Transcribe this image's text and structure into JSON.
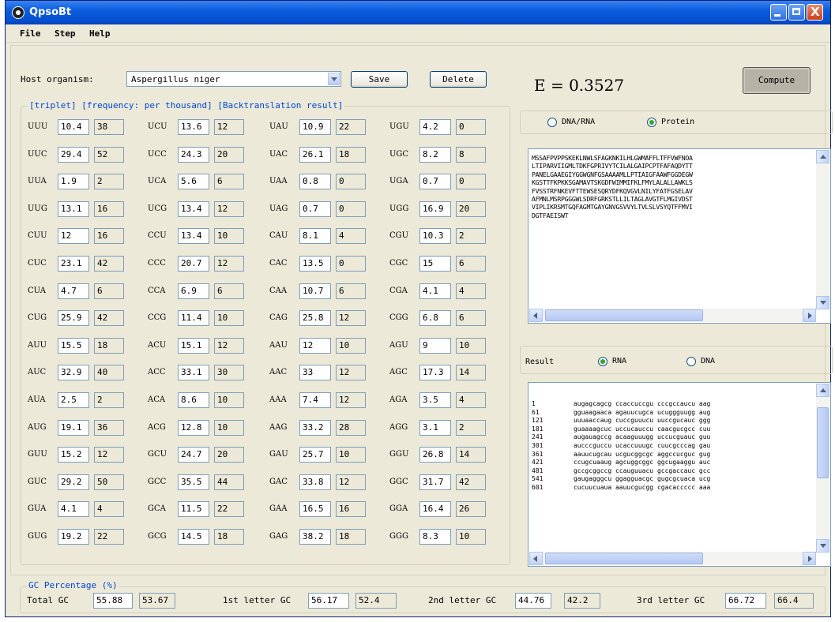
{
  "window": {
    "title": "QpsoBt",
    "close_glyph": "X"
  },
  "menu": [
    "File",
    "Step",
    "Help"
  ],
  "host": {
    "label": "Host organism:",
    "value": "Aspergillus niger",
    "save": "Save",
    "delete": "Delete"
  },
  "energy": "E = 0.3527",
  "compute": "Compute",
  "triplet_group": "[triplet] [frequency: per thousand] [Backtranslation result]",
  "codons": [
    [
      [
        "UUU",
        "10.4",
        "38"
      ],
      [
        "UCU",
        "13.6",
        "12"
      ],
      [
        "UAU",
        "10.9",
        "22"
      ],
      [
        "UGU",
        "4.2",
        "0"
      ]
    ],
    [
      [
        "UUC",
        "29.4",
        "52"
      ],
      [
        "UCC",
        "24.3",
        "20"
      ],
      [
        "UAC",
        "26.1",
        "18"
      ],
      [
        "UGC",
        "8.2",
        "8"
      ]
    ],
    [
      [
        "UUA",
        "1.9",
        "2"
      ],
      [
        "UCA",
        "5.6",
        "6"
      ],
      [
        "UAA",
        "0.8",
        "0"
      ],
      [
        "UGA",
        "0.7",
        "0"
      ]
    ],
    [
      [
        "UUG",
        "13.1",
        "16"
      ],
      [
        "UCG",
        "13.4",
        "12"
      ],
      [
        "UAG",
        "0.7",
        "0"
      ],
      [
        "UGG",
        "16.9",
        "20"
      ]
    ],
    [
      [
        "CUU",
        "12",
        "16"
      ],
      [
        "CCU",
        "13.4",
        "10"
      ],
      [
        "CAU",
        "8.1",
        "4"
      ],
      [
        "CGU",
        "10.3",
        "2"
      ]
    ],
    [
      [
        "CUC",
        "23.1",
        "42"
      ],
      [
        "CCC",
        "20.7",
        "12"
      ],
      [
        "CAC",
        "13.5",
        "0"
      ],
      [
        "CGC",
        "15",
        "6"
      ]
    ],
    [
      [
        "CUA",
        "4.7",
        "6"
      ],
      [
        "CCA",
        "6.9",
        "6"
      ],
      [
        "CAA",
        "10.7",
        "6"
      ],
      [
        "CGA",
        "4.1",
        "4"
      ]
    ],
    [
      [
        "CUG",
        "25.9",
        "42"
      ],
      [
        "CCG",
        "11.4",
        "10"
      ],
      [
        "CAG",
        "25.8",
        "12"
      ],
      [
        "CGG",
        "6.8",
        "6"
      ]
    ],
    [
      [
        "AUU",
        "15.5",
        "18"
      ],
      [
        "ACU",
        "15.1",
        "12"
      ],
      [
        "AAU",
        "12",
        "10"
      ],
      [
        "AGU",
        "9",
        "10"
      ]
    ],
    [
      [
        "AUC",
        "32.9",
        "40"
      ],
      [
        "ACC",
        "33.1",
        "30"
      ],
      [
        "AAC",
        "33",
        "12"
      ],
      [
        "AGC",
        "17.3",
        "14"
      ]
    ],
    [
      [
        "AUA",
        "2.5",
        "2"
      ],
      [
        "ACA",
        "8.6",
        "10"
      ],
      [
        "AAA",
        "7.4",
        "12"
      ],
      [
        "AGA",
        "3.5",
        "4"
      ]
    ],
    [
      [
        "AUG",
        "19.1",
        "36"
      ],
      [
        "ACG",
        "12.8",
        "10"
      ],
      [
        "AAG",
        "33.2",
        "28"
      ],
      [
        "AGG",
        "3.1",
        "2"
      ]
    ],
    [
      [
        "GUU",
        "15.2",
        "12"
      ],
      [
        "GCU",
        "24.7",
        "20"
      ],
      [
        "GAU",
        "25.7",
        "10"
      ],
      [
        "GGU",
        "26.8",
        "14"
      ]
    ],
    [
      [
        "GUC",
        "29.2",
        "50"
      ],
      [
        "GCC",
        "35.5",
        "44"
      ],
      [
        "GAC",
        "33.8",
        "12"
      ],
      [
        "GGC",
        "31.7",
        "42"
      ]
    ],
    [
      [
        "GUA",
        "4.1",
        "4"
      ],
      [
        "GCA",
        "11.5",
        "22"
      ],
      [
        "GAA",
        "16.5",
        "16"
      ],
      [
        "GGA",
        "16.4",
        "26"
      ]
    ],
    [
      [
        "GUG",
        "19.2",
        "22"
      ],
      [
        "GCG",
        "14.5",
        "18"
      ],
      [
        "GAG",
        "38.2",
        "18"
      ],
      [
        "GGG",
        "8.3",
        "10"
      ]
    ]
  ],
  "seq_type": {
    "dna_rna": "DNA/RNA",
    "protein": "Protein",
    "selected": "Protein"
  },
  "protein_seq": [
    "MSSAFPVPPSKEKLNWLSFAGKNKILHLGWMAFFLTFFVWFNOA",
    "LTIPARVIIGMLTDKFGPRIVYTCILALGAIPCPTFAFAQDYTT",
    "PANELGAAEGIYGGWGNFGSAAAAMLLPTIAIGFAAWFGGDEGW",
    "KGSTTFKPKKSGAMAVTSKGDFWIMMIFKLFMYLALALLAWKLS",
    "FVSSTRFNKEVFTTEWSESQRYDFKQVGVLNILYFATFGSELAV",
    "AFMNLMSRPGGGWLSDRFGRKSTLLILTAGLAVGTFLMGIVDST",
    "VIPLIKRSMTGQFAGMTGAYGNVGSVVYLTVLSLVSYQTFFMVI",
    "DGTFAEISWT"
  ],
  "result": {
    "label": "Result",
    "rna": "RNA",
    "dna": "DNA",
    "selected": "RNA"
  },
  "result_lines": [
    "1          augagcagcg ccaccuccgu cccgccaucu aag",
    "61         gguaagaaca agauucugca ucuggguugg aug",
    "121        uuuaaccaug cuccguuucu uuccgucauc ggg",
    "181        guaaaagcuc uccucauccu caacgucgcc cuu",
    "241        augauagccg acaaguuugg uccucguauc guu",
    "301        aucccguccu ucaccuuugc cuucgcccag gau",
    "361        aauucugcau ucgucggcgc aggccucguc gug",
    "421        ccugcuaaug agcuggcggc ggcugaaggu auc",
    "481        gccgcggccg ccauguuacu gccgaccauc gcc",
    "541        gaugagggcu ggagguacgc gugcgcuaca ucg",
    "601        cucuucuaua aauucgucgg cgacaccccc aaa"
  ],
  "gc": {
    "title": "GC Percentage (%)",
    "total_label": "Total GC",
    "total": [
      "55.88",
      "53.67"
    ],
    "first_label": "1st letter GC",
    "first": [
      "56.17",
      "52.4"
    ],
    "second_label": "2nd letter GC",
    "second": [
      "44.76",
      "42.2"
    ],
    "third_label": "3rd letter GC",
    "third": [
      "66.72",
      "66.4"
    ]
  },
  "colors": {
    "titlebar": "#0a5ddb",
    "group_title": "#0046d5",
    "radio_selected": "#2ea72e"
  },
  "icons": [
    "app-icon",
    "minimize-icon",
    "maximize-icon",
    "close-icon",
    "dropdown-arrow-icon",
    "scroll-left-icon",
    "scroll-right-icon",
    "scroll-up-icon",
    "scroll-down-icon"
  ]
}
